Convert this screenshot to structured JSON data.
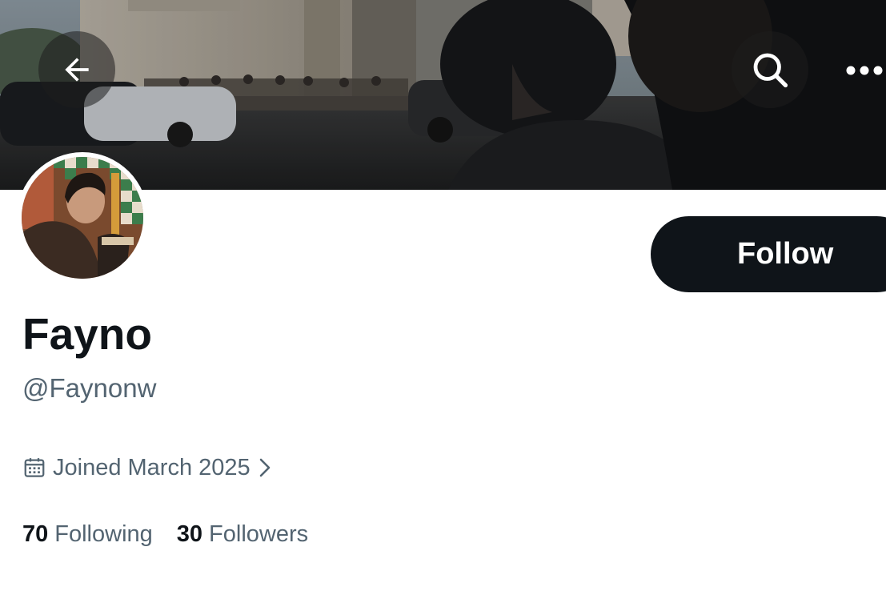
{
  "header": {
    "back_icon": "arrow-left-icon",
    "search_icon": "search-icon",
    "more_icon": "more-horizontal-icon"
  },
  "profile": {
    "display_name": "Fayno",
    "handle": "@Faynonw",
    "joined_text": "Joined March 2025",
    "joined_icon": "calendar-icon",
    "follow_label": "Follow"
  },
  "stats": {
    "following_count": "70",
    "following_label": "Following",
    "followers_count": "30",
    "followers_label": "Followers"
  },
  "colors": {
    "text_primary": "#0f1419",
    "text_secondary": "#536471",
    "follow_button_bg": "#0f1419",
    "follow_button_text": "#ffffff",
    "background": "#ffffff"
  }
}
